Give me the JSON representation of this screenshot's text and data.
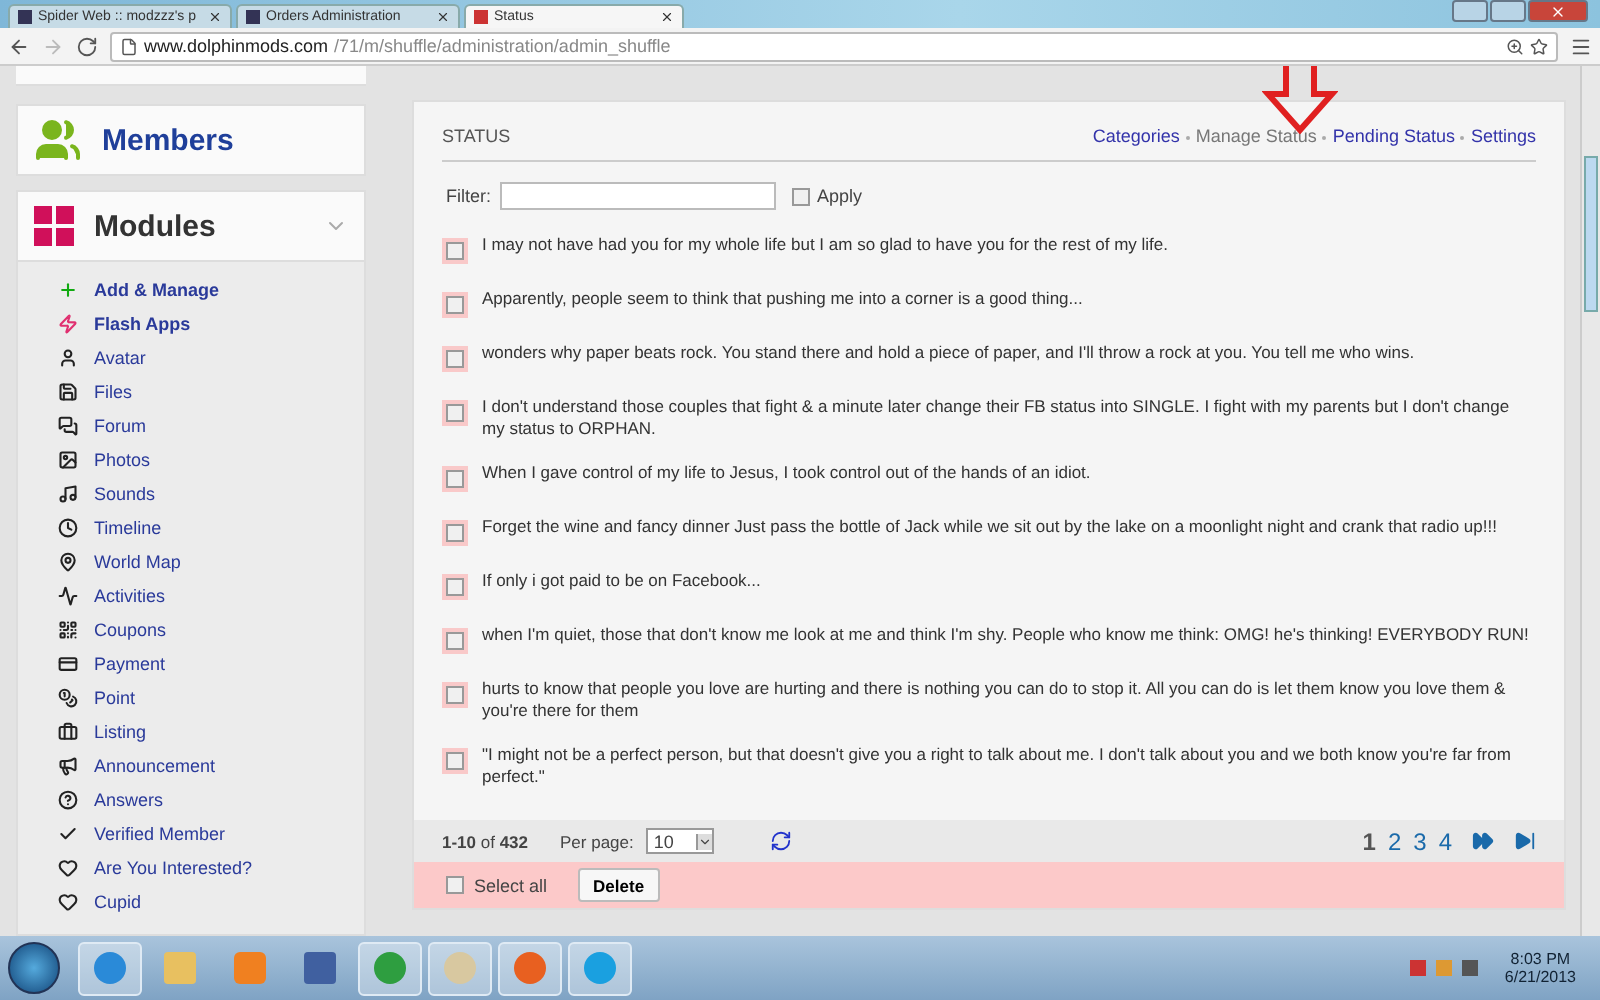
{
  "browser": {
    "tabs": [
      {
        "label": "Spider Web :: modzzz's p",
        "selected": false
      },
      {
        "label": "Orders Administration",
        "selected": false
      },
      {
        "label": "Status",
        "selected": true
      }
    ],
    "url": {
      "host": "www.dolphinmods.com",
      "path": "/71/m/shuffle/administration/admin_shuffle"
    }
  },
  "sidebar": {
    "members_title": "Members",
    "modules": {
      "title": "Modules",
      "expanded": true,
      "items": [
        {
          "label": "Add & Manage",
          "highlighted": true
        },
        {
          "label": "Flash Apps",
          "highlighted": true
        },
        {
          "label": "Avatar",
          "highlighted": false
        },
        {
          "label": "Files",
          "highlighted": false
        },
        {
          "label": "Forum",
          "highlighted": false
        },
        {
          "label": "Photos",
          "highlighted": false
        },
        {
          "label": "Sounds",
          "highlighted": false
        },
        {
          "label": "Timeline",
          "highlighted": false
        },
        {
          "label": "World Map",
          "highlighted": false
        },
        {
          "label": "Activities",
          "highlighted": false
        },
        {
          "label": "Coupons",
          "highlighted": false
        },
        {
          "label": "Payment",
          "highlighted": false
        },
        {
          "label": "Point",
          "highlighted": false
        },
        {
          "label": "Listing",
          "highlighted": false
        },
        {
          "label": "Announcement",
          "highlighted": false
        },
        {
          "label": "Answers",
          "highlighted": false
        },
        {
          "label": "Verified Member",
          "highlighted": false
        },
        {
          "label": "Are You Interested?",
          "highlighted": false
        },
        {
          "label": "Cupid",
          "highlighted": false
        }
      ]
    }
  },
  "panel": {
    "title": "STATUS",
    "nav": [
      {
        "label": "Categories",
        "selected": false
      },
      {
        "label": "Manage Status",
        "selected": true
      },
      {
        "label": "Pending Status",
        "selected": false
      },
      {
        "label": "Settings",
        "selected": false
      }
    ],
    "filter": {
      "label": "Filter:",
      "apply": {
        "label": "Apply",
        "checked": false
      }
    },
    "statuses": [
      {
        "text": "I may not have had you for my whole life but I am so glad to have you for the rest of my life.",
        "checked": false
      },
      {
        "text": "Apparently, people seem to think that pushing me into a corner is a good thing...",
        "checked": false
      },
      {
        "text": "wonders why paper beats rock. You stand there and hold a piece of paper, and I'll throw a rock at you. You tell me who wins.",
        "checked": false
      },
      {
        "text": "I don't understand those couples that fight & a minute later change their FB status into SINGLE. I fight with my parents but I don't change my status to ORPHAN.",
        "checked": false
      },
      {
        "text": "When I gave control of my life to Jesus, I took control out of the hands of an idiot.",
        "checked": false
      },
      {
        "text": "Forget the wine and fancy dinner Just pass the bottle of Jack while we sit out by the lake on a moonlight night and crank that radio up!!!",
        "checked": false
      },
      {
        "text": "If only i got paid to be on Facebook...",
        "checked": false
      },
      {
        "text": "when I'm quiet, those that don't know me look at me and think I'm shy. People who know me think: OMG! he's thinking! EVERYBODY RUN!",
        "checked": false
      },
      {
        "text": "hurts to know that people you love are hurting and there is nothing you can do to stop it. All you can do is let them know you love them & you're there for them",
        "checked": false
      },
      {
        "text": "\"I might not be a perfect person, but that doesn't give you a right to talk about me. I don't talk about you and we both know you're far from perfect.\"",
        "checked": false
      }
    ],
    "footer": {
      "range": "**1-10** of **432**",
      "per_page_label": "Per page:",
      "per_page": "10",
      "pages": [
        {
          "label": "1",
          "selected": true
        },
        {
          "label": "2",
          "selected": false
        },
        {
          "label": "3",
          "selected": false
        },
        {
          "label": "4",
          "selected": false
        }
      ]
    },
    "actions": {
      "select_all": {
        "label": "Select all",
        "checked": false
      },
      "delete": "Delete"
    }
  },
  "taskbar": {
    "time": "8:03 PM",
    "date": "6/21/2013"
  }
}
